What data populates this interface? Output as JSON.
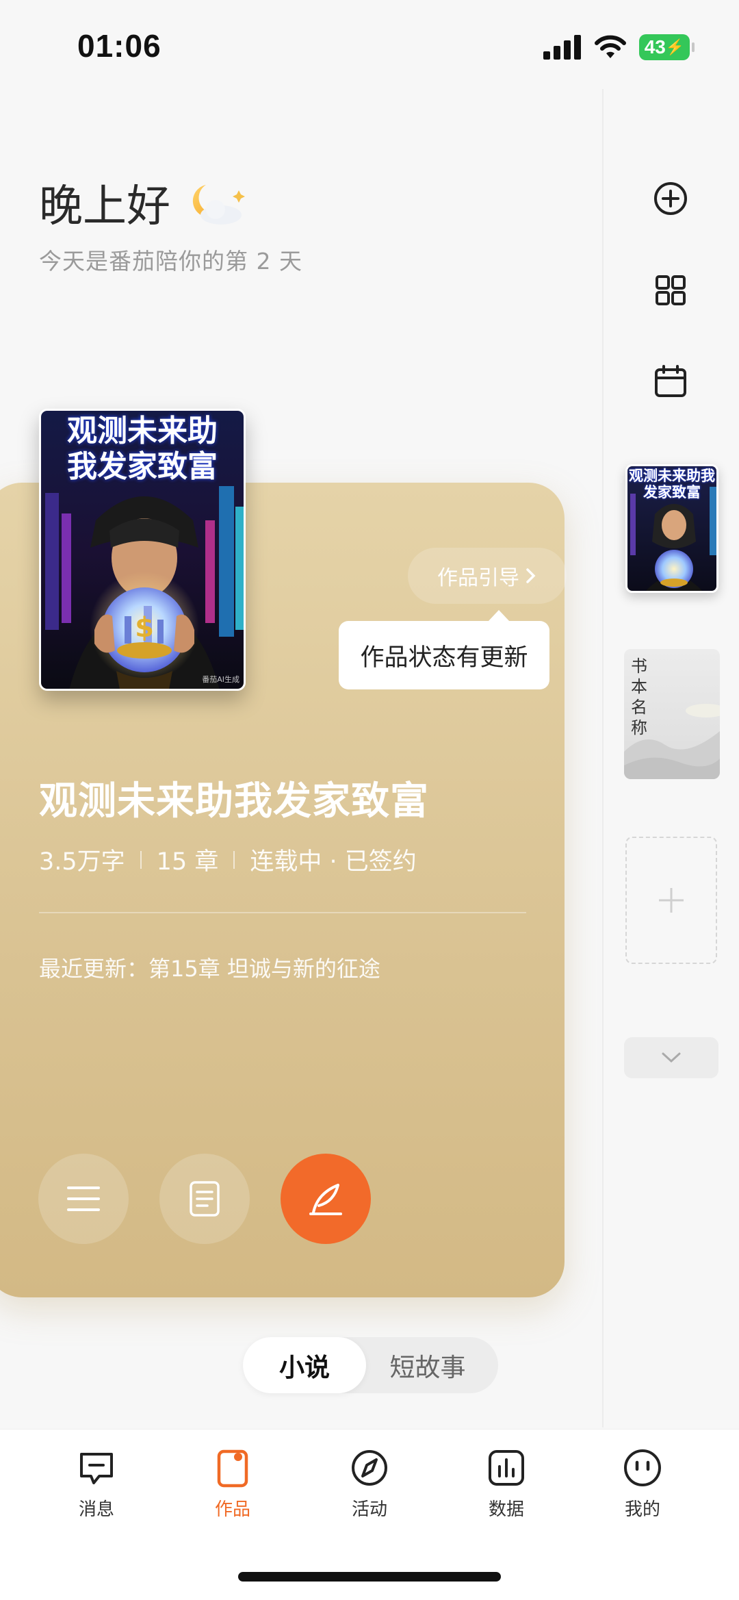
{
  "status_bar": {
    "time": "01:06",
    "battery": "43"
  },
  "greeting": {
    "title": "晚上好",
    "subtitle": "今天是番茄陪你的第 2 天"
  },
  "right_rail": {
    "placeholder_book_title": "书本名称",
    "mini_cover_title": "观测未来助我发家致富"
  },
  "card": {
    "cover_title_line1": "观测未来助",
    "cover_title_line2": "我发家致富",
    "cover_watermark": "番茄AI生成",
    "guide_label": "作品引导",
    "tooltip": "作品状态有更新",
    "book_title": "观测未来助我发家致富",
    "word_count": "3.5万字",
    "chapters": "15 章",
    "status": "连载中 · 已签约",
    "latest_update": "最近更新：第15章 坦诚与新的征途"
  },
  "segment": {
    "items": [
      "小说",
      "短故事"
    ],
    "selected": "小说"
  },
  "bottom_nav": {
    "items": [
      {
        "label": "消息",
        "icon": "message-icon"
      },
      {
        "label": "作品",
        "icon": "works-icon"
      },
      {
        "label": "活动",
        "icon": "compass-icon"
      },
      {
        "label": "数据",
        "icon": "chart-icon"
      },
      {
        "label": "我的",
        "icon": "face-icon"
      }
    ],
    "active": "作品"
  },
  "colors": {
    "accent": "#f06a25",
    "card": "#dcc596",
    "battery": "#34c759"
  }
}
